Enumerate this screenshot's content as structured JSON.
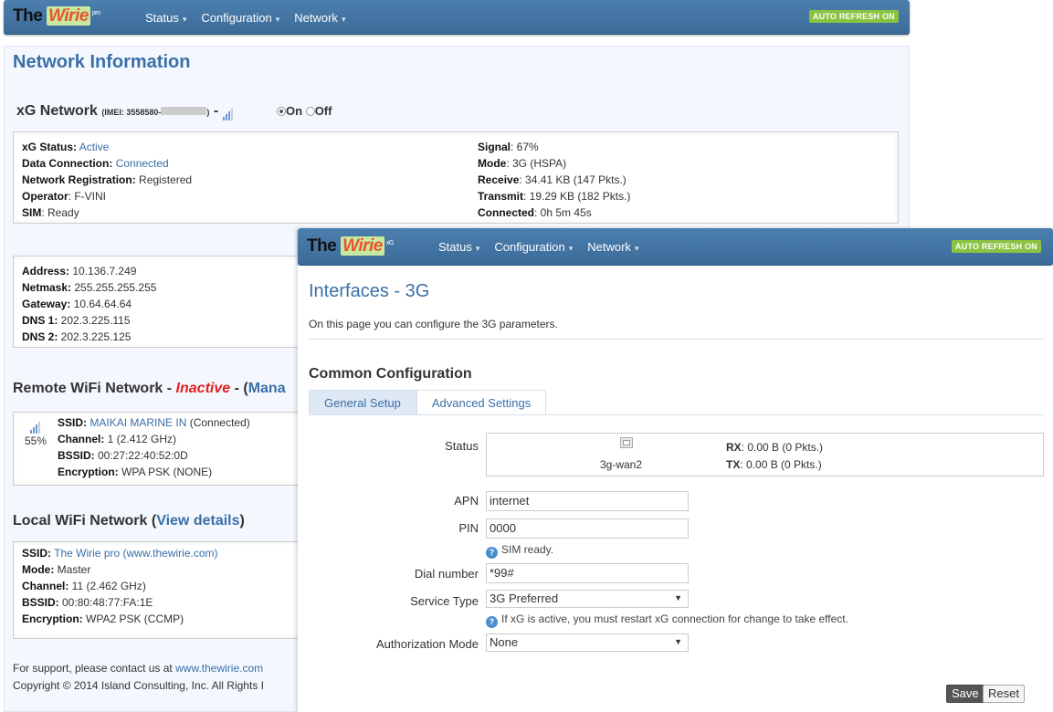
{
  "back": {
    "brand": {
      "pre": "The ",
      "mid": "Wirie",
      "sup": "pro"
    },
    "nav": [
      "Status",
      "Configuration",
      "Network"
    ],
    "auto_refresh": "AUTO REFRESH ON",
    "title": "Network Information",
    "xg": {
      "heading": "xG Network",
      "imei": "(IMEI: 3558580-",
      "imei_end": ")",
      "dash": "-",
      "on": "On",
      "off": "Off",
      "left": [
        {
          "label": "xG Status:",
          "value": "Active",
          "link": true
        },
        {
          "label": "Data Connection:",
          "value": "Connected",
          "link": true
        },
        {
          "label": "Network Registration:",
          "value": "Registered",
          "link": false
        },
        {
          "label": "Operator",
          "value": ": F-VINI",
          "link": false
        },
        {
          "label": "SIM",
          "value": ": Ready",
          "link": false
        }
      ],
      "right": [
        {
          "label": "Signal",
          "value": ": 67%"
        },
        {
          "label": "Mode",
          "value": ": 3G (HSPA)"
        },
        {
          "label": "Receive",
          "value": ": 34.41 KB (147 Pkts.)"
        },
        {
          "label": "Transmit",
          "value": ": 19.29 KB (182 Pkts.)"
        },
        {
          "label": "Connected",
          "value": ": 0h 5m 45s"
        }
      ]
    },
    "ip": [
      {
        "label": "Address:",
        "value": " 10.136.7.249"
      },
      {
        "label": "Netmask:",
        "value": " 255.255.255.255"
      },
      {
        "label": "Gateway:",
        "value": " 10.64.64.64"
      },
      {
        "label": "DNS 1:",
        "value": " 202.3.225.115"
      },
      {
        "label": "DNS 2:",
        "value": " 202.3.225.125"
      }
    ],
    "remote": {
      "prefix": "Remote WiFi Network - ",
      "status": "Inactive",
      "suffix": " - (",
      "link": "Mana",
      "signal_pct": "55%",
      "ssid_label": "SSID:",
      "ssid": "MAIKAI MARINE IN",
      "ssid_state": " (Connected)",
      "channel_label": "Channel:",
      "channel": " 1 (2.412 GHz)",
      "bssid_label": "BSSID:",
      "bssid": " 00:27:22:40:52:0D",
      "enc_label": "Encryption:",
      "enc": " WPA PSK (NONE)"
    },
    "local": {
      "prefix": "Local WiFi Network (",
      "link": "View details",
      "suffix": ")",
      "ssid_label": "SSID:",
      "ssid": "The Wirie pro (www.thewirie.com)",
      "mode_label": "Mode:",
      "mode": " Master",
      "channel_label": "Channel:",
      "channel": " 11 (2.462 GHz)",
      "bssid_label": "BSSID:",
      "bssid": " 00:80:48:77:FA:1E",
      "enc_label": "Encryption:",
      "enc": " WPA2 PSK (CCMP)"
    },
    "footer": {
      "support": "For support, please contact us at ",
      "support_link": "www.thewirie.com",
      "copyright": "Copyright © 2014 Island Consulting, Inc. All Rights I"
    }
  },
  "front": {
    "brand": {
      "pre": "The ",
      "mid": "Wirie",
      "sup": "xG"
    },
    "nav": [
      "Status",
      "Configuration",
      "Network"
    ],
    "auto_refresh": "AUTO REFRESH ON",
    "title": "Interfaces - 3G",
    "description": "On this page you can configure the 3G parameters.",
    "section": "Common Configuration",
    "tabs": [
      "General Setup",
      "Advanced Settings"
    ],
    "status": {
      "label": "Status",
      "iface": "3g-wan2",
      "rx_label": "RX",
      "rx": ": 0.00 B (0 Pkts.)",
      "tx_label": "TX",
      "tx": ": 0.00 B (0 Pkts.)"
    },
    "fields": {
      "apn_label": "APN",
      "apn": "internet",
      "pin_label": "PIN",
      "pin": "0000",
      "pin_hint": "SIM ready.",
      "dial_label": "Dial number",
      "dial": "*99#",
      "service_label": "Service Type",
      "service": "3G Preferred",
      "service_hint": "If xG is active, you must restart xG connection for change to take effect.",
      "auth_label": "Authorization Mode",
      "auth": "None"
    },
    "buttons": {
      "save": "Save",
      "reset": "Reset"
    }
  },
  "colors": {
    "accent": "#3a6fa8",
    "navbar": "#3f709f",
    "badge": "#8ac341",
    "inactive": "#e02020"
  }
}
